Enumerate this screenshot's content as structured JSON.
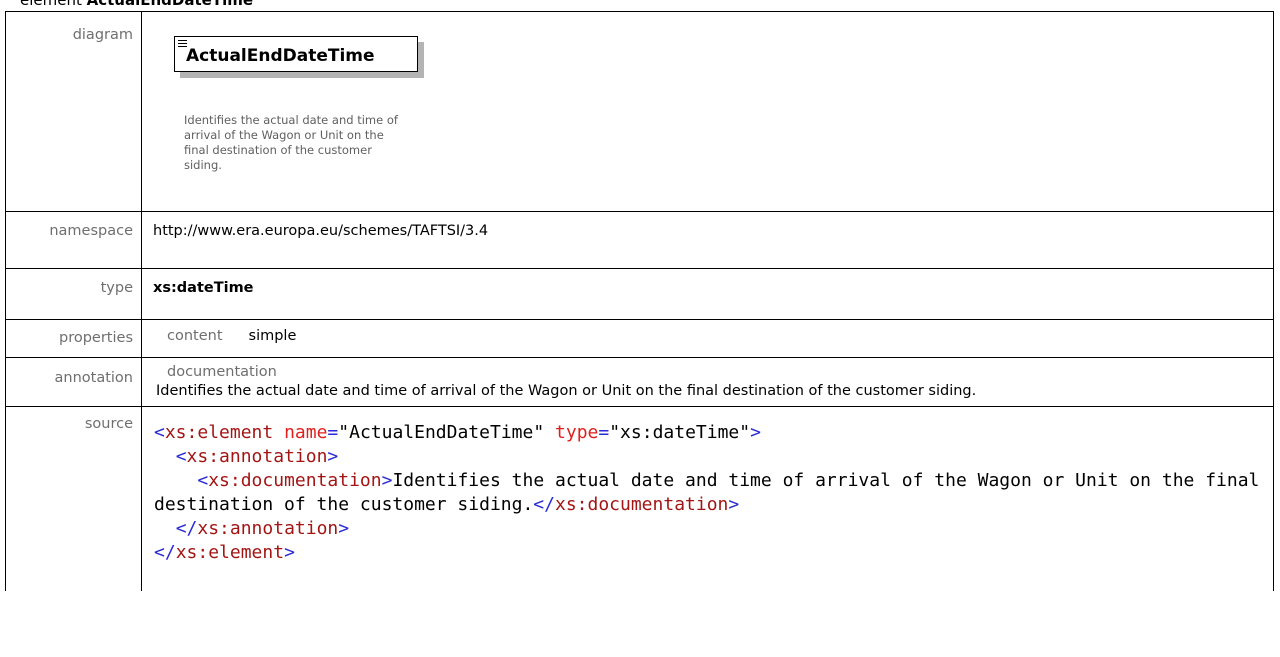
{
  "header": {
    "kind": "element",
    "name": "ActualEndDateTime"
  },
  "rows": {
    "diagram_label": "diagram",
    "namespace_label": "namespace",
    "type_label": "type",
    "properties_label": "properties",
    "annotation_label": "annotation",
    "source_label": "source"
  },
  "diagram": {
    "element_name": "ActualEndDateTime",
    "documentation": "Identifies the actual date and time of arrival of the Wagon or Unit on the final destination of the customer siding."
  },
  "namespace": "http://www.era.europa.eu/schemes/TAFTSI/3.4",
  "type": "xs:dateTime",
  "properties": {
    "key": "content",
    "value": "simple"
  },
  "annotation": {
    "key": "documentation",
    "text": "Identifies the actual date and time of arrival of the Wagon or Unit on the final destination of the customer siding."
  },
  "source": {
    "open_tag": "xs:element",
    "attr1_name": "name",
    "attr1_value": "\"ActualEndDateTime\"",
    "attr2_name": "type",
    "attr2_value": "\"xs:dateTime\"",
    "annotation_tag": "xs:annotation",
    "documentation_tag": "xs:documentation",
    "documentation_text": "Identifies the actual date and time of arrival of the Wagon or Unit on the final destination of the customer siding."
  }
}
